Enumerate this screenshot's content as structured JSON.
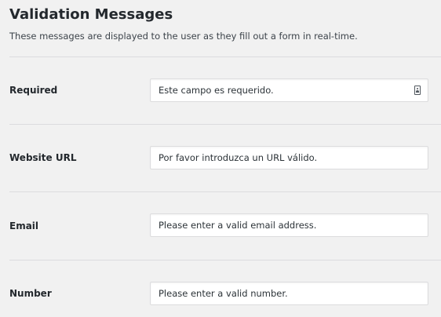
{
  "header": {
    "title": "Validation Messages",
    "description": "These messages are displayed to the user as they fill out a form in real-time."
  },
  "rows": [
    {
      "label": "Required",
      "value": "Este campo es requerido.",
      "icon": "contact-card-icon"
    },
    {
      "label": "Website URL",
      "value": "Por favor introduzca un URL válido."
    },
    {
      "label": "Email",
      "value": "Please enter a valid email address."
    },
    {
      "label": "Number",
      "value": "Please enter a valid number."
    }
  ],
  "colors": {
    "background": "#f1f1f1",
    "field_background": "#ffffff",
    "field_border": "#dcdcde",
    "divider": "#dcdcde",
    "text": "#23282d"
  }
}
